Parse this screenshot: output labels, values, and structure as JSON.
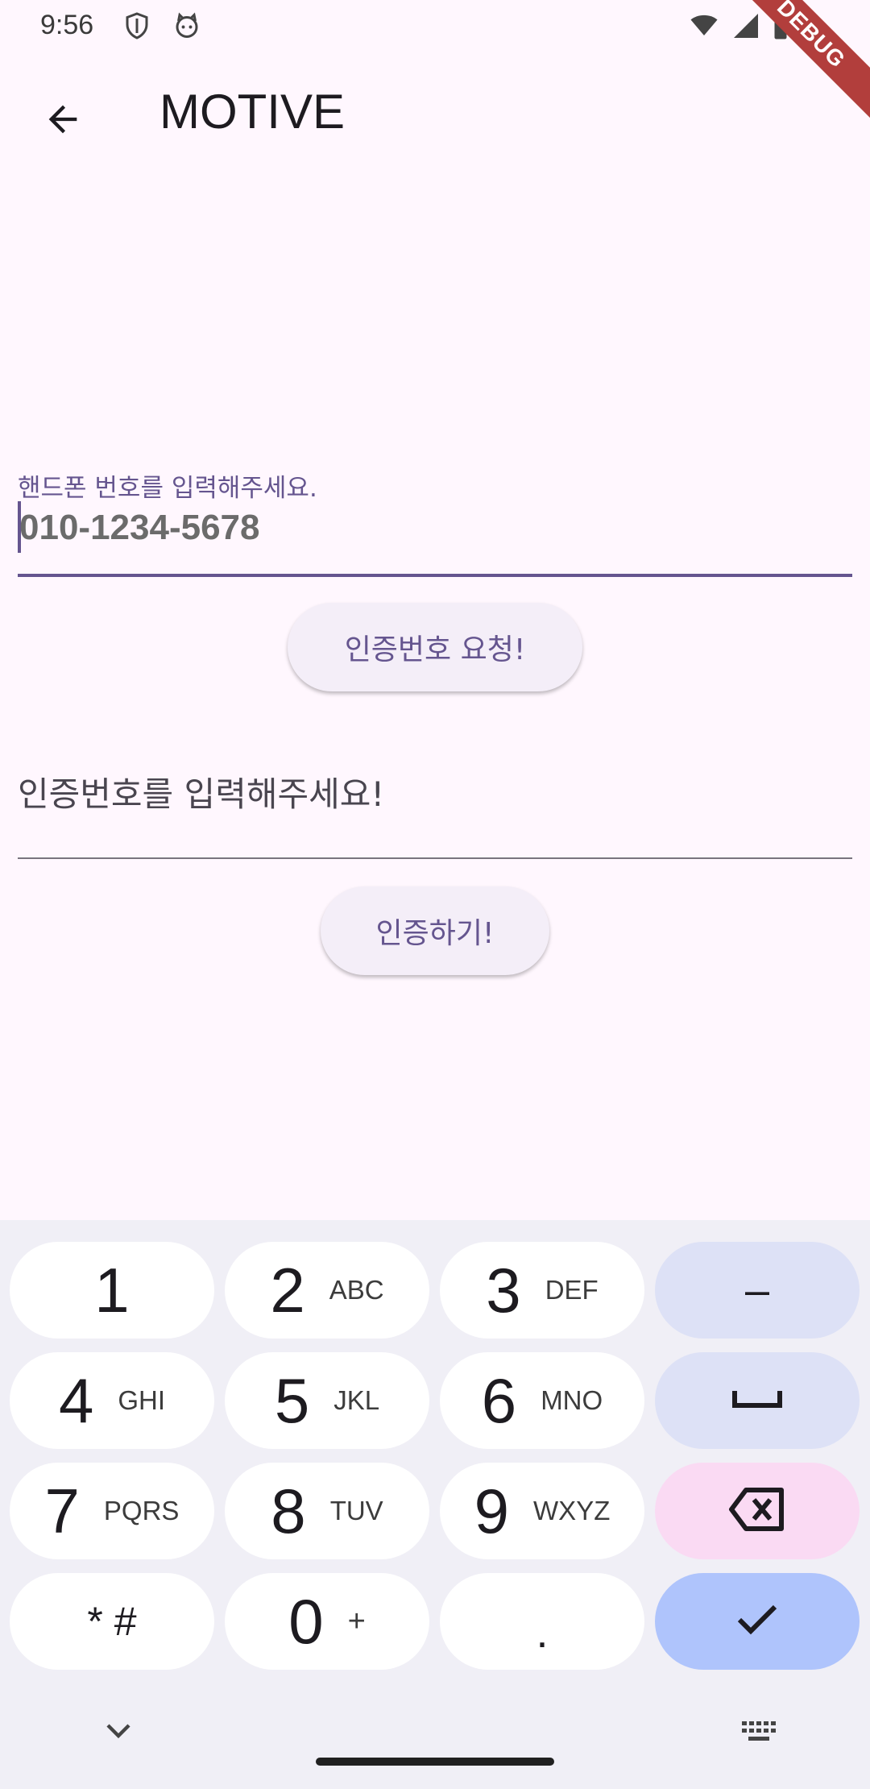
{
  "status_bar": {
    "time": "9:56",
    "icons": [
      "shield-icon",
      "cat-icon",
      "wifi-icon",
      "signal-icon",
      "battery-icon"
    ]
  },
  "debug_banner": "DEBUG",
  "app_bar": {
    "back_icon": "arrow-back-icon",
    "title": "MOTIVE"
  },
  "phone_field": {
    "label": "핸드폰 번호를 입력해주세요.",
    "placeholder": "010-1234-5678",
    "value": ""
  },
  "request_button": {
    "label": "인증번호 요청!"
  },
  "code_field": {
    "placeholder": "인증번호를 입력해주세요!",
    "value": ""
  },
  "verify_button": {
    "label": "인증하기!"
  },
  "keyboard": {
    "rows": [
      [
        {
          "digit": "1",
          "letters": ""
        },
        {
          "digit": "2",
          "letters": "ABC"
        },
        {
          "digit": "3",
          "letters": "DEF"
        },
        {
          "symbol": "–",
          "icon": "dash-icon"
        }
      ],
      [
        {
          "digit": "4",
          "letters": "GHI"
        },
        {
          "digit": "5",
          "letters": "JKL"
        },
        {
          "digit": "6",
          "letters": "MNO"
        },
        {
          "symbol": "",
          "icon": "space-icon"
        }
      ],
      [
        {
          "digit": "7",
          "letters": "PQRS"
        },
        {
          "digit": "8",
          "letters": "TUV"
        },
        {
          "digit": "9",
          "letters": "WXYZ"
        },
        {
          "symbol": "",
          "icon": "backspace-icon"
        }
      ],
      [
        {
          "digit": "* #",
          "letters": ""
        },
        {
          "digit": "0",
          "letters": "+"
        },
        {
          "digit": ".",
          "letters": ""
        },
        {
          "symbol": "",
          "icon": "check-icon"
        }
      ]
    ],
    "colors": {
      "key": "#FFFFFF",
      "function_key": "#DDE1F6",
      "backspace_key": "#FADAF3",
      "done_key": "#AFC4FC",
      "background": "#F0EFF6"
    },
    "bottom_icons": [
      "chevron-down-icon",
      "keyboard-icon"
    ]
  },
  "theme": {
    "primary": "#65558F",
    "background": "#FFF7FE",
    "button_bg": "#F4EEF8"
  }
}
